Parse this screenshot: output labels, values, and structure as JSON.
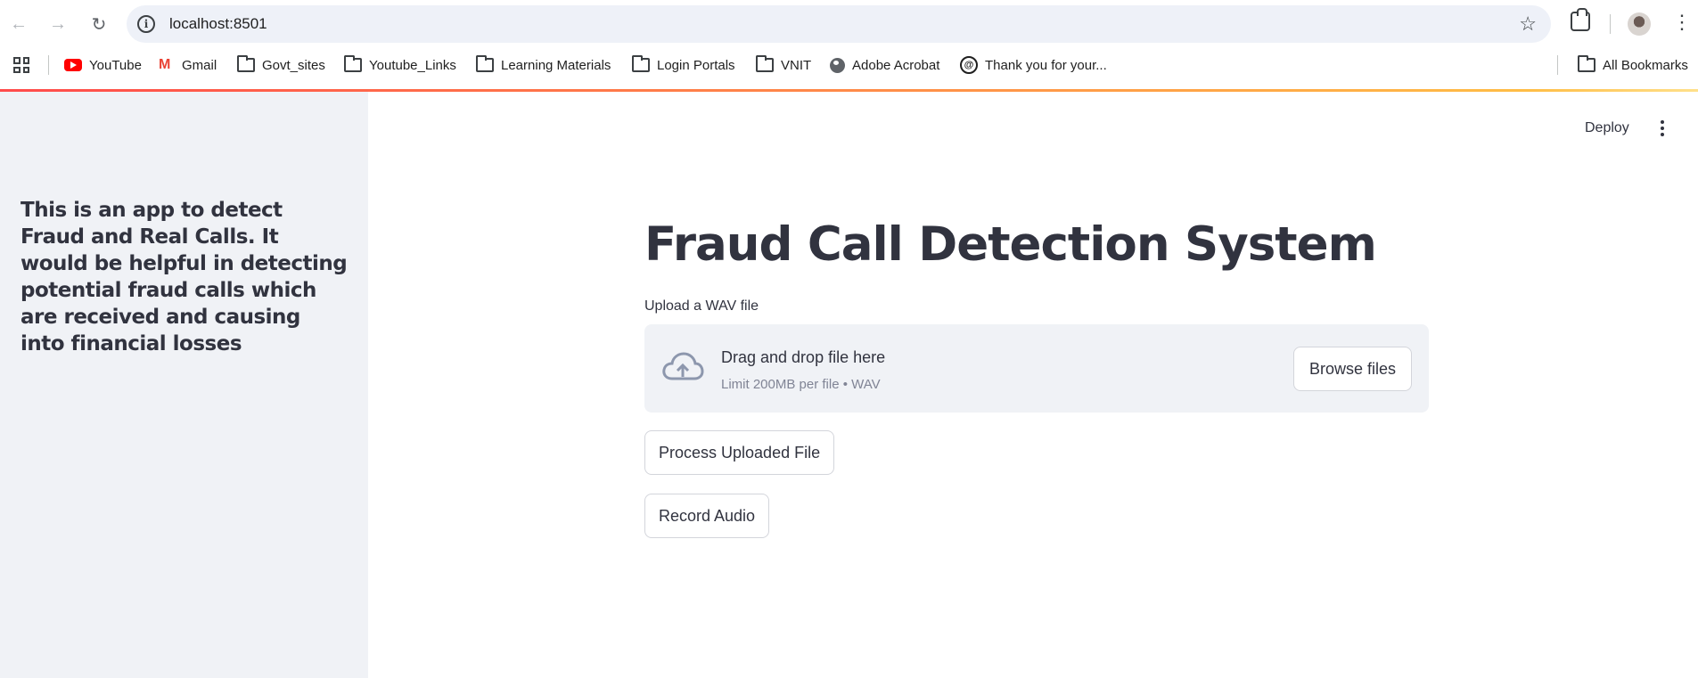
{
  "browser": {
    "url": "localhost:8501"
  },
  "bookmarks": [
    {
      "label": "YouTube",
      "icon": "youtube-icon"
    },
    {
      "label": "Gmail",
      "icon": "gmail-icon"
    },
    {
      "label": "Govt_sites",
      "icon": "folder-icon"
    },
    {
      "label": "Youtube_Links",
      "icon": "folder-icon"
    },
    {
      "label": "Learning Materials",
      "icon": "folder-icon"
    },
    {
      "label": "Login Portals",
      "icon": "folder-icon"
    },
    {
      "label": "VNIT",
      "icon": "folder-icon"
    },
    {
      "label": "Adobe Acrobat",
      "icon": "globe-icon"
    },
    {
      "label": "Thank you for your...",
      "icon": "site-icon"
    }
  ],
  "all_bookmarks": "All Bookmarks",
  "sidebar": {
    "description": "This is an app to detect Fraud and Real Calls. It would be helpful in detecting potential fraud calls which are received and causing into financial losses"
  },
  "header": {
    "deploy_label": "Deploy"
  },
  "main": {
    "title": "Fraud Call Detection System",
    "upload_label": "Upload a WAV file",
    "dropzone_title": "Drag and drop file here",
    "dropzone_limit": "Limit 200MB per file • WAV",
    "browse_label": "Browse files",
    "process_label": "Process Uploaded File",
    "record_label": "Record Audio"
  },
  "colors": {
    "accent_gradient_start": "#ff4b4b",
    "accent_gradient_end": "#ffbd45",
    "sidebar_bg": "#f0f2f6",
    "text": "#31333f"
  }
}
